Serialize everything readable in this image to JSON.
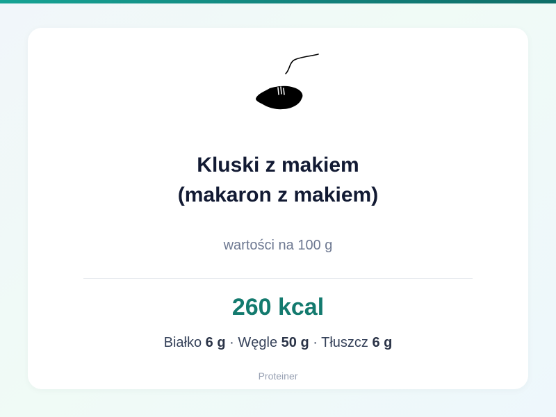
{
  "recipe": {
    "title_line1": "Kluski z makiem",
    "title_line2": "(makaron z makiem)",
    "basis": "wartości na 100 g",
    "icon": "noodles-with-poppy-seeds-icon"
  },
  "nutrition": {
    "calories": "260 kcal",
    "protein_label": "Białko",
    "protein_value": "6 g",
    "carbs_label": "Węgle",
    "carbs_value": "50 g",
    "fat_label": "Tłuszcz",
    "fat_value": "6 g",
    "separator": "·"
  },
  "footer": {
    "brand": "Proteiner"
  },
  "colors": {
    "accent": "#137a6e",
    "title": "#121a33",
    "muted": "#6d7891",
    "top_bar": "#16a394"
  }
}
